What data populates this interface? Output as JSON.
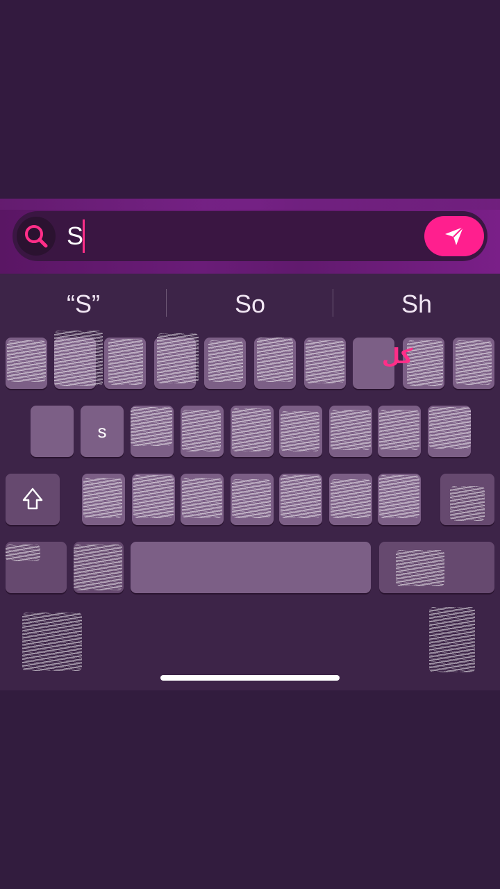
{
  "search": {
    "value": "S",
    "colors": {
      "accent": "#ff1f8e",
      "field_bg": "#3a1642",
      "band": "#6a1c78"
    }
  },
  "suggestions": [
    "“S”",
    "So",
    "Sh"
  ],
  "keyboard": {
    "visible_key_label": "s",
    "glyph_label": "کل",
    "icons": [
      "shift-icon",
      "return-icon",
      "search-icon",
      "send-icon"
    ]
  }
}
